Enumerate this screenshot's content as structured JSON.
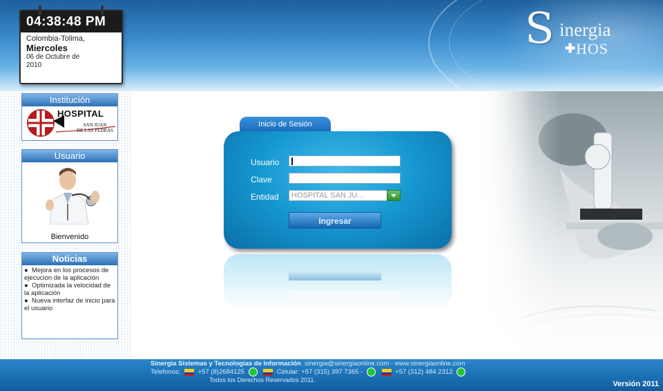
{
  "header": {
    "clock_time": "04:38:48 PM",
    "location": "Colombia-Tolima,",
    "weekday": "Miercoles",
    "date_line1": "06 de Octubre de",
    "date_line2": "2010",
    "brand_first": "S",
    "brand_rest": "inergia",
    "brand_product": "HOS"
  },
  "sidebar": {
    "institution_title": "Institución",
    "hospital_name": "HOSPITAL",
    "hospital_sub1": "SAN JUAN",
    "hospital_sub2": "DE LAS PEDRAS",
    "user_title": "Usuario",
    "welcome": "Bienvenido",
    "news_title": "Noticias",
    "news_items": [
      "Mejora en los procesos de ejecucion de la aplicación",
      "Optimizada la velocidad de la aplicación",
      "Nueva interfaz de inicio para el usuario"
    ]
  },
  "login": {
    "tab_label": "Inicio de Sesión",
    "user_label": "Usuario",
    "user_value": "",
    "password_label": "Clave",
    "password_value": "",
    "entity_label": "Entidad",
    "entity_selected": "HOSPITAL SAN JU...",
    "submit_label": "Ingresar"
  },
  "footer": {
    "company": "Sinergia Sistemas y Tecnologías de Información",
    "contact_line": "sinergia@sinergiaonline.com - www.sinergiaonline.com",
    "phones_label": "Telefonos",
    "phone1": "+57 (8)2684125",
    "cell_label": "Celular: +57 (315) 397 7365 -",
    "phone3": "+57 (312) 484 2312",
    "rights": "Todos los Derechos Reservados 2011.",
    "version": "Versión 2011"
  },
  "colors": {
    "header_blue": "#1d5f9c",
    "login_blue": "#1596cf",
    "footer_blue": "#0f5da1",
    "select_green": "#2e8f2c"
  }
}
